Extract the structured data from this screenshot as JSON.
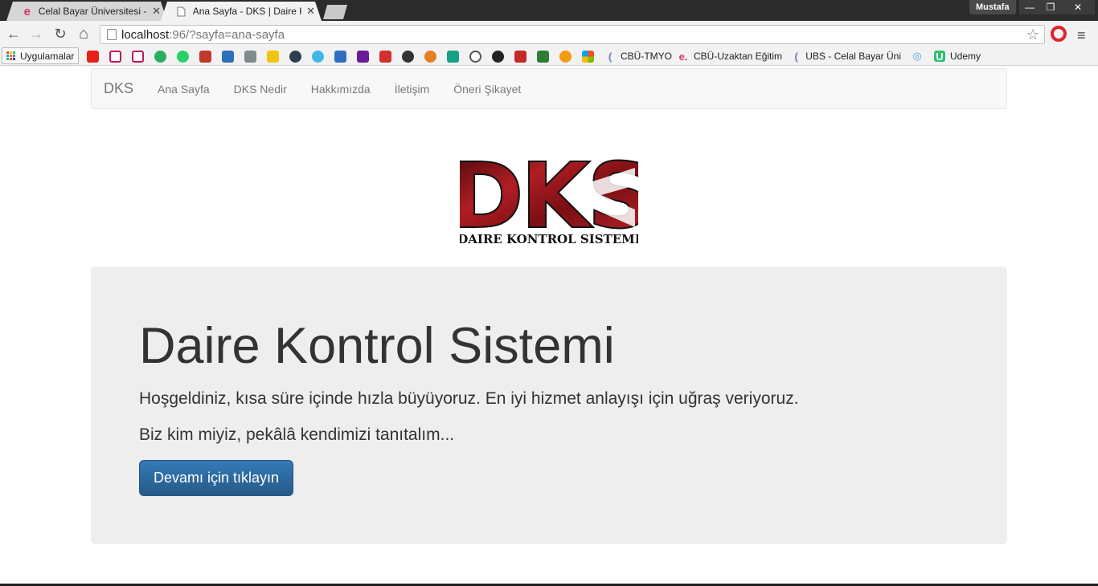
{
  "browser": {
    "tabs": [
      {
        "title": "Celal Bayar Üniversitesi - C",
        "icon": "e",
        "icon_color": "#d6336c",
        "active": false
      },
      {
        "title": "Ana Sayfa - DKS | Daire Kc",
        "icon": "",
        "active": true
      }
    ],
    "tab_close": "✕",
    "profile_name": "Mustafa",
    "window_controls": {
      "minimize": "—",
      "restore": "❐",
      "close": "✕"
    },
    "url_host": "localhost",
    "url_rest": ":96/?sayfa=ana-sayfa",
    "nav_icons": {
      "back": "←",
      "forward": "→",
      "reload": "↻",
      "home": "⌂",
      "star": "☆",
      "menu": "≡"
    },
    "bookmarks": {
      "apps_label": "Uygulamalar",
      "labeled": [
        {
          "label": "CBÜ-TMYO",
          "icon": "(",
          "icon_color": "#6b7fb3"
        },
        {
          "label": "CBÜ-Uzaktan Eğitim",
          "icon": "e.",
          "icon_color": "#d6336c"
        },
        {
          "label": "UBS - Celal Bayar Üni",
          "icon": "(",
          "icon_color": "#6b7fb3"
        },
        {
          "label": "",
          "icon": "◎",
          "icon_color": "#4aa3df"
        },
        {
          "label": "Udemy",
          "icon": "U",
          "icon_color": "#2fbf71"
        }
      ]
    }
  },
  "navbar": {
    "brand": "DKS",
    "links": [
      "Ana Sayfa",
      "DKS Nedir",
      "Hakkımızda",
      "İletişim",
      "Öneri Şikayet"
    ]
  },
  "logo": {
    "letters": "DKS",
    "caption": "DAIRE KONTROL SISTEMI"
  },
  "jumbotron": {
    "title": "Daire Kontrol Sistemi",
    "lead1": "Hoşgeldiniz, kısa süre içinde hızla büyüyoruz. En iyi hizmet anlayışı için uğraş veriyoruz.",
    "lead2": "Biz kim miyiz, pekâlâ kendimizi tanıtalım...",
    "button": "Devamı için tıklayın"
  },
  "colors": {
    "primary_button": "#337ab7",
    "jumbotron_bg": "#eeeeee",
    "navbar_bg": "#f8f8f8",
    "logo_red": "#b01e23"
  }
}
